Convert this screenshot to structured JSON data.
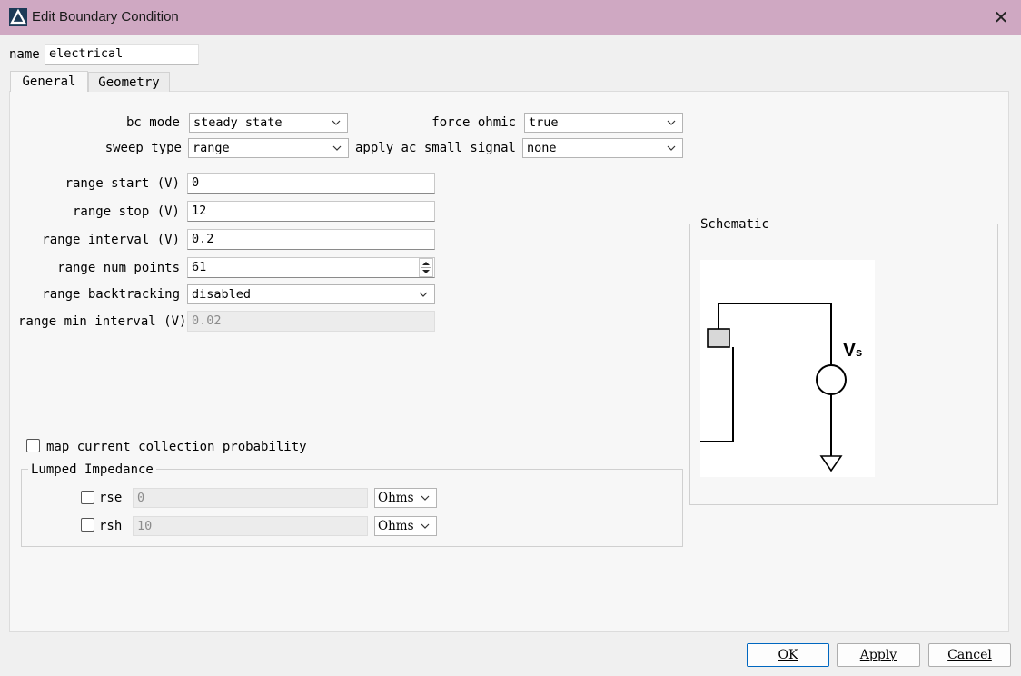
{
  "window": {
    "title": "Edit Boundary Condition"
  },
  "name": {
    "label": "name",
    "value": "electrical"
  },
  "tabs": [
    {
      "label": "General"
    },
    {
      "label": "Geometry"
    }
  ],
  "general": {
    "bc_mode": {
      "label": "bc mode",
      "value": "steady state"
    },
    "force_ohmic": {
      "label": "force ohmic",
      "value": "true"
    },
    "sweep_type": {
      "label": "sweep type",
      "value": "range"
    },
    "apply_ac": {
      "label": "apply ac small signal",
      "value": "none"
    },
    "range_start": {
      "label": "range start  (V)",
      "value": "0"
    },
    "range_stop": {
      "label": "range stop  (V)",
      "value": "12"
    },
    "range_interval": {
      "label": "range interval  (V)",
      "value": "0.2"
    },
    "range_num_points": {
      "label": "range num points",
      "value": "61"
    },
    "range_backtracking": {
      "label": "range backtracking",
      "value": "disabled"
    },
    "range_min_interval": {
      "label": "range min interval  (V)",
      "value": "0.02"
    },
    "map_current": {
      "label": "map current collection probability",
      "checked": false
    },
    "lumped": {
      "title": "Lumped Impedance",
      "rse": {
        "label": "rse",
        "value": "0",
        "unit": "Ohms",
        "checked": false
      },
      "rsh": {
        "label": "rsh",
        "value": "10",
        "unit": "Ohms",
        "checked": false
      }
    },
    "schematic": {
      "title": "Schematic",
      "source_label": "V",
      "source_sub": "s"
    }
  },
  "buttons": {
    "ok": "OK",
    "apply": "Apply",
    "cancel": "Cancel"
  },
  "icons": {
    "app": "app-logo-icon",
    "close": "close-icon",
    "dropdown": "chevron-down-icon"
  }
}
